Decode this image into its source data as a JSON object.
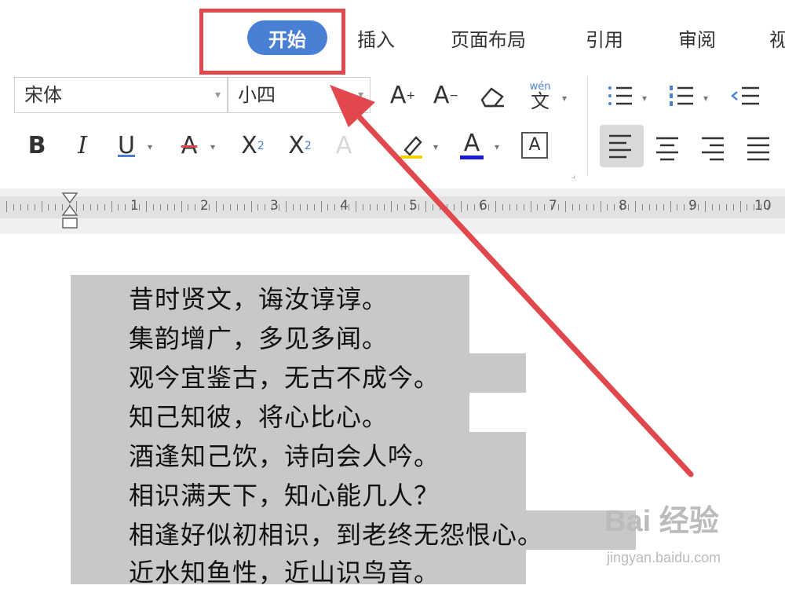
{
  "menu": {
    "tabs": [
      {
        "label": "开始",
        "active": true
      },
      {
        "label": "插入"
      },
      {
        "label": "页面布局"
      },
      {
        "label": "引用"
      },
      {
        "label": "审阅"
      },
      {
        "label": "视"
      }
    ]
  },
  "toolbar": {
    "font_name": "宋体",
    "font_size": "小四",
    "dropdown_arrow": "▾",
    "grow_font": "A",
    "shrink_font": "A",
    "grow_sup": "+",
    "shrink_sup": "−",
    "pinyin_top": "wén",
    "pinyin_char": "文",
    "bold": "B",
    "italic": "I",
    "underline": "U",
    "strike": "A",
    "superscript": "X",
    "superscript_mark": "2",
    "subscript": "X",
    "subscript_mark": "2",
    "text_effect": "A",
    "font_color": "A",
    "char_border": "A"
  },
  "ruler": {
    "numbers": [
      "1",
      "2",
      "3",
      "4",
      "5",
      "6",
      "7",
      "8",
      "9",
      "10"
    ]
  },
  "document": {
    "lines": [
      "昔时贤文，诲汝谆谆。",
      "集韵增广，多见多闻。",
      "观今宜鉴古，无古不成今。",
      "知己知彼，将心比心。",
      "酒逢知己饮，诗向会人吟。",
      "相识满天下，知心能几人？",
      "相逢好似初相识，到老终无怨恨心。",
      "近水知鱼性，近山识鸟音。"
    ]
  },
  "colors": {
    "accent": "#4a7fd6",
    "annotation": "#e0484d",
    "selection": "#c8c8c8"
  },
  "watermark": {
    "brand": "Bai 经验",
    "url": "jingyan.baidu.com"
  }
}
